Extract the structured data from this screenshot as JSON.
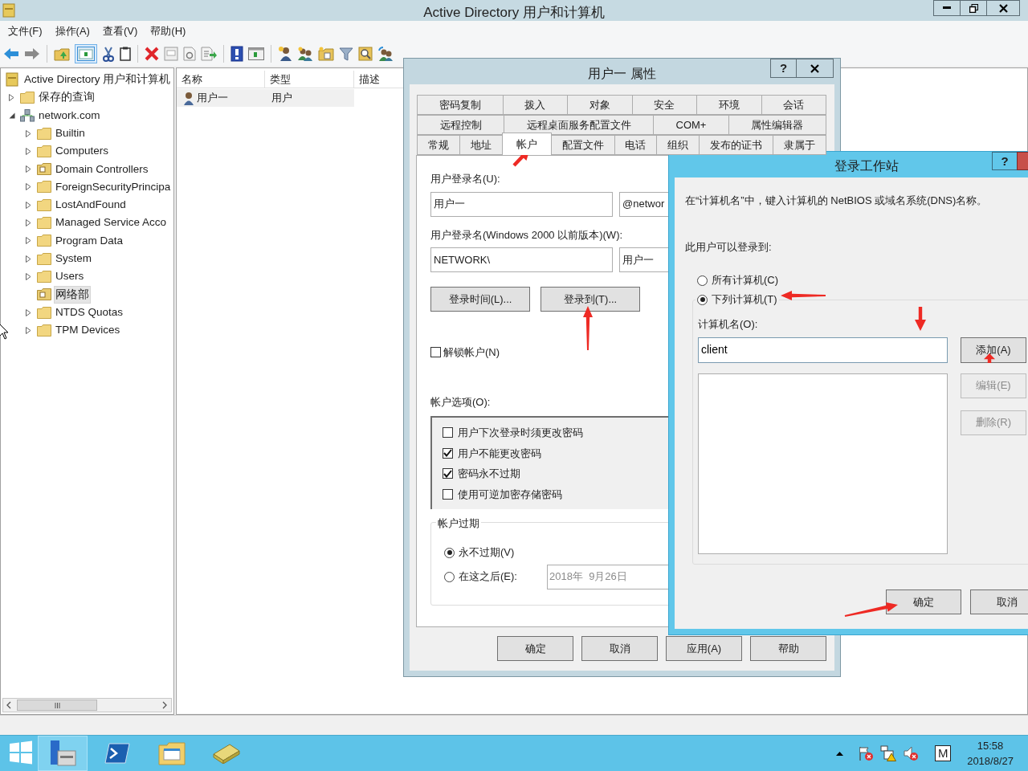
{
  "window": {
    "title": "Active Directory 用户和计算机"
  },
  "menu": [
    "文件(F)",
    "操作(A)",
    "查看(V)",
    "帮助(H)"
  ],
  "tree": {
    "label": "Active Directory 用户和计算机",
    "children": [
      {
        "label": "保存的查询",
        "kind": "folder",
        "expandable": true,
        "expanded": false,
        "selected": false
      },
      {
        "label": "network.com",
        "kind": "domain",
        "expandable": true,
        "expanded": true,
        "selected": false,
        "children": [
          {
            "label": "Builtin",
            "kind": "folder",
            "expandable": true,
            "expanded": false,
            "selected": false
          },
          {
            "label": "Computers",
            "kind": "folder",
            "expandable": true,
            "expanded": false,
            "selected": false
          },
          {
            "label": "Domain Controllers",
            "kind": "ou",
            "expandable": true,
            "expanded": false,
            "selected": false
          },
          {
            "label": "ForeignSecurityPrincipa",
            "kind": "folder",
            "expandable": true,
            "expanded": false,
            "selected": false
          },
          {
            "label": "LostAndFound",
            "kind": "folder",
            "expandable": true,
            "expanded": false,
            "selected": false
          },
          {
            "label": "Managed Service Acco",
            "kind": "folder",
            "expandable": true,
            "expanded": false,
            "selected": false
          },
          {
            "label": "Program Data",
            "kind": "folder",
            "expandable": true,
            "expanded": false,
            "selected": false
          },
          {
            "label": "System",
            "kind": "folder",
            "expandable": true,
            "expanded": false,
            "selected": false
          },
          {
            "label": "Users",
            "kind": "folder",
            "expandable": true,
            "expanded": false,
            "selected": false
          },
          {
            "label": "网络部",
            "kind": "ou",
            "expandable": false,
            "expanded": false,
            "selected": true
          },
          {
            "label": "NTDS Quotas",
            "kind": "folder",
            "expandable": true,
            "expanded": false,
            "selected": false
          },
          {
            "label": "TPM Devices",
            "kind": "folder",
            "expandable": true,
            "expanded": false,
            "selected": false
          }
        ]
      }
    ]
  },
  "list": {
    "columns": [
      "名称",
      "类型",
      "描述"
    ],
    "rows": [
      {
        "cells": [
          "用户一",
          "用户"
        ],
        "selected": true
      }
    ]
  },
  "properties_dialog": {
    "title": "用户一 属性",
    "help": "?",
    "tab_rows": [
      [
        {
          "label": "密码复制",
          "selected": false
        },
        {
          "label": "拨入",
          "selected": false
        },
        {
          "label": "对象",
          "selected": false
        },
        {
          "label": "安全",
          "selected": false
        },
        {
          "label": "环境",
          "selected": false
        },
        {
          "label": "会话",
          "selected": false
        }
      ],
      [
        {
          "label": "远程控制",
          "selected": false
        },
        {
          "label": "远程桌面服务配置文件",
          "selected": false
        },
        {
          "label": "COM+",
          "selected": false
        },
        {
          "label": "属性编辑器",
          "selected": false
        }
      ],
      [
        {
          "label": "常规",
          "selected": false
        },
        {
          "label": "地址",
          "selected": false
        },
        {
          "label": "帐户",
          "selected": true
        },
        {
          "label": "配置文件",
          "selected": false
        },
        {
          "label": "电话",
          "selected": false
        },
        {
          "label": "组织",
          "selected": false
        },
        {
          "label": "发布的证书",
          "selected": false
        },
        {
          "label": "隶属于",
          "selected": false
        }
      ]
    ],
    "logon_label": "用户登录名(U):",
    "logon_name": "用户一",
    "logon_suffix": "@networ",
    "pre2000_label": "用户登录名(Windows 2000 以前版本)(W):",
    "pre2000_domain": "NETWORK\\",
    "pre2000_name": "用户一",
    "buttons": [
      "登录时间(L)...",
      "登录到(T)..."
    ],
    "unlock": {
      "label": "解锁帐户(N)",
      "checked": false
    },
    "options_label": "帐户选项(O):",
    "options": [
      {
        "label": "用户下次登录时须更改密码",
        "checked": false
      },
      {
        "label": "用户不能更改密码",
        "checked": true
      },
      {
        "label": "密码永不过期",
        "checked": true
      },
      {
        "label": "使用可逆加密存储密码",
        "checked": false
      }
    ],
    "expiry": {
      "legend": "帐户过期",
      "choices": [
        {
          "label": "永不过期(V)",
          "selected": true
        },
        {
          "label": "在这之后(E):",
          "selected": false
        }
      ],
      "date": "2018年  9月26日"
    },
    "footer": [
      "确定",
      "取消",
      "应用(A)",
      "帮助"
    ]
  },
  "workstations_dialog": {
    "title": "登录工作站",
    "help": "?",
    "instruction": "在“计算机名”中，键入计算机的 NetBIOS 或域名系统(DNS)名称。",
    "can_logon_label": "此用户可以登录到:",
    "choices": [
      {
        "label": "所有计算机(C)",
        "selected": false
      },
      {
        "label": "下列计算机(T)",
        "selected": true
      }
    ],
    "computer_label": "计算机名(O):",
    "computer_value": "client",
    "side_buttons": [
      {
        "label": "添加(A)",
        "disabled": false
      },
      {
        "label": "编辑(E)",
        "disabled": true
      },
      {
        "label": "删除(R)",
        "disabled": true
      }
    ],
    "footer": [
      "确定",
      "取消"
    ]
  },
  "taskbar": {
    "keyboard": "M",
    "time": "15:58",
    "date": "2018/8/27"
  }
}
